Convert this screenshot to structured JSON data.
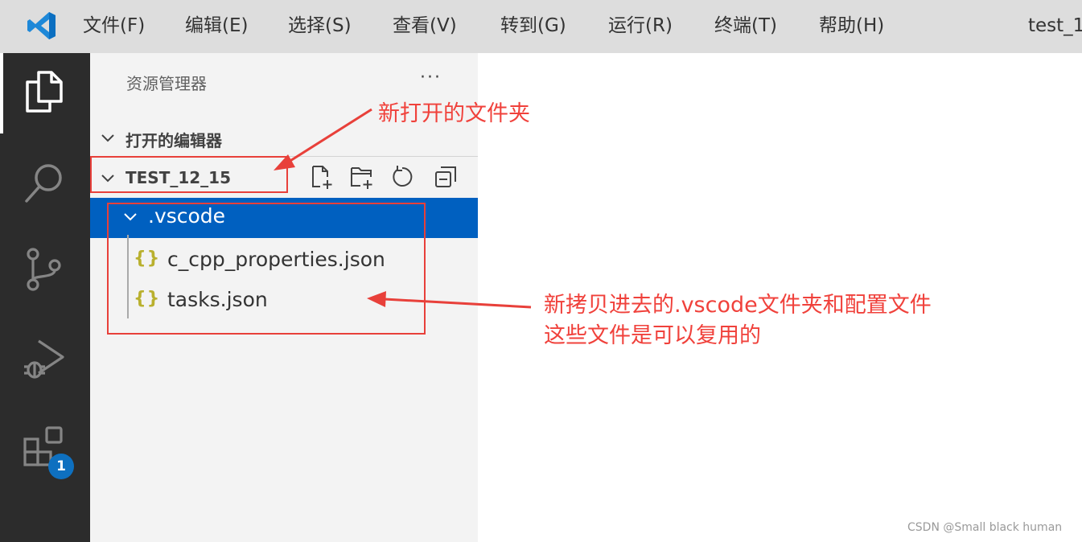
{
  "menubar": {
    "logo": "vscode-logo",
    "items": [
      {
        "label": "文件(F)"
      },
      {
        "label": "编辑(E)"
      },
      {
        "label": "选择(S)"
      },
      {
        "label": "查看(V)"
      },
      {
        "label": "转到(G)"
      },
      {
        "label": "运行(R)"
      },
      {
        "label": "终端(T)"
      },
      {
        "label": "帮助(H)"
      }
    ],
    "window_title": "test_1"
  },
  "activity_bar": {
    "icons": [
      "explorer-icon",
      "search-icon",
      "source-control-icon",
      "run-debug-icon",
      "extensions-icon"
    ],
    "extensions_badge": "1"
  },
  "explorer": {
    "title": "资源管理器",
    "more": "···",
    "open_editors": "打开的编辑器",
    "folder_name": "TEST_12_15",
    "toolbar_icons": [
      "new-file-icon",
      "new-folder-icon",
      "refresh-icon",
      "collapse-all-icon"
    ],
    "tree": {
      "folder": ".vscode",
      "files": [
        {
          "name": "c_cpp_properties.json",
          "icon": "{}"
        },
        {
          "name": "tasks.json",
          "icon": "{}"
        }
      ]
    }
  },
  "annotations": {
    "new_folder_note": "新打开的文件夹",
    "copied_note_line1": "新拷贝进去的.vscode文件夹和配置文件",
    "copied_note_line2": "这些文件是可以复用的",
    "color": "#f0413b"
  },
  "watermark": "CSDN @Small black human",
  "colors": {
    "menubar_bg": "#dddddd",
    "activitybar_bg": "#2c2c2c",
    "sidebar_bg": "#f3f3f3",
    "selection_bg": "#0060c0",
    "badge_bg": "#0e70c0",
    "json_icon": "#b9b02e"
  }
}
